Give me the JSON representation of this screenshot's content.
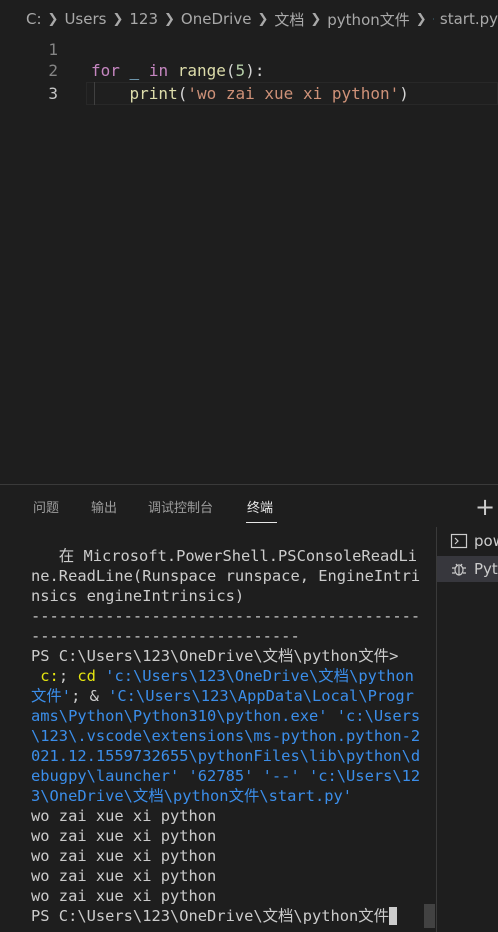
{
  "breadcrumb": {
    "items": [
      "C:",
      "Users",
      "123",
      "OneDrive",
      "文档",
      "python文件",
      "start.py"
    ],
    "file_icon": "python-file-icon"
  },
  "editor": {
    "line_numbers": [
      "1",
      "2",
      "3"
    ],
    "line2": {
      "kw_for": "for",
      "var": "_",
      "kw_in": "in",
      "fn": "range",
      "open": "(",
      "num": "5",
      "close": "):"
    },
    "line3": {
      "fn": "print",
      "open": "(",
      "str": "'wo zai xue xi python'",
      "close": ")"
    }
  },
  "panel": {
    "tabs": [
      "问题",
      "输出",
      "调试控制台",
      "终端"
    ],
    "active_tab": "终端",
    "add_button": "+"
  },
  "terminal": {
    "lines": [
      "   在 Microsoft.PowerShell.PSConsoleReadLi",
      "ne.ReadLine(Runspace runspace, EngineIntri",
      "nsics engineIntrinsics)",
      "------------------------------------------",
      "-----------------------------",
      "PS C:\\Users\\123\\OneDrive\\文档\\python文件>"
    ],
    "cmd_lines": [
      {
        "yellow": " c:",
        "rest": "; ",
        "yellow2": "cd",
        "blue": " 'c:\\Users\\123\\OneDrive\\文档\\python"
      },
      {
        "blue": "文件'",
        "rest": "; & ",
        "blue2": "'C:\\Users\\123\\AppData\\Local\\Progr"
      },
      {
        "blue": "ams\\Python\\Python310\\python.exe' 'c:\\Users"
      },
      {
        "blue": "\\123\\.vscode\\extensions\\ms-python.python-2"
      },
      {
        "blue": "021.12.1559732655\\pythonFiles\\lib\\python\\d"
      },
      {
        "blue": "ebugpy\\launcher' '62785' '--' 'c:\\Users\\12"
      },
      {
        "blue": "3\\OneDrive\\文档\\python文件\\start.py'"
      }
    ],
    "output": [
      "wo zai xue xi python",
      "wo zai xue xi python",
      "wo zai xue xi python",
      "wo zai xue xi python",
      "wo zai xue xi python"
    ],
    "prompt": "PS C:\\Users\\123\\OneDrive\\文档\\python文件"
  },
  "terminal_list": [
    {
      "label": "powershell",
      "icon": "terminal-icon"
    },
    {
      "label": "Python Debug Console",
      "icon": "debug-icon"
    }
  ]
}
